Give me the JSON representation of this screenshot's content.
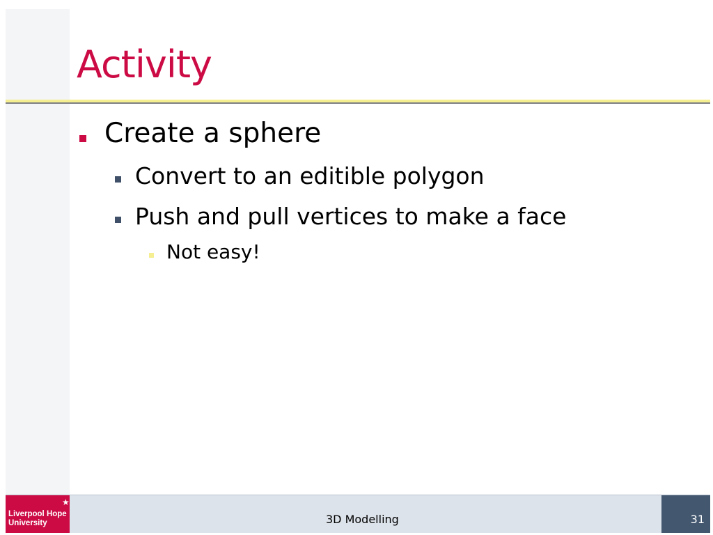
{
  "slide": {
    "title": "Activity",
    "bullets": [
      {
        "level": 1,
        "text": "Create a sphere"
      },
      {
        "level": 2,
        "text": "Convert to an editible polygon"
      },
      {
        "level": 2,
        "text": "Push and pull vertices to make a face"
      },
      {
        "level": 3,
        "text": "Not easy!"
      }
    ]
  },
  "footer": {
    "logo_line1": "Liverpool Hope",
    "logo_line2": "University",
    "logo_icon": "star-icon",
    "center_text": "3D Modelling",
    "page_number": "31"
  },
  "colors": {
    "title": "#cc0b45",
    "bullet_level1": "#cc0b45",
    "bullet_level2": "#3f5068",
    "bullet_level3": "#f5ef92",
    "rule": "#f5ef92",
    "footer_bg": "#dde3ea",
    "logo_bg": "#cc0b45",
    "page_box_bg": "#43576f"
  }
}
